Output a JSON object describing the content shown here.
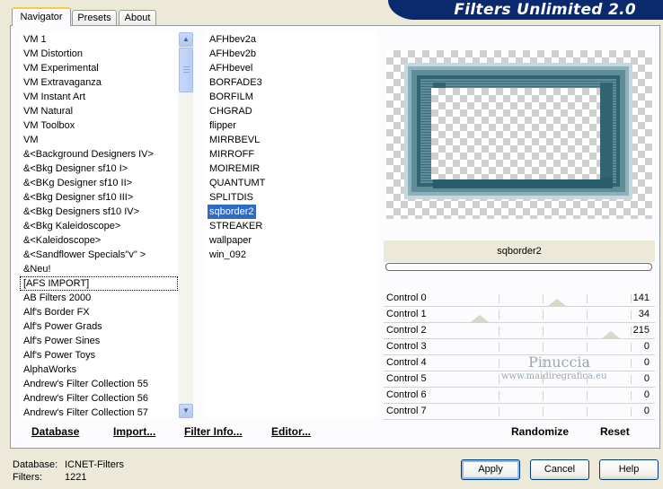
{
  "banner": {
    "title": "Filters Unlimited 2.0"
  },
  "tabs": [
    {
      "label": "Navigator",
      "active": true
    },
    {
      "label": "Presets",
      "active": false
    },
    {
      "label": "About",
      "active": false
    }
  ],
  "categories": [
    "VM 1",
    "VM Distortion",
    "VM Experimental",
    "VM Extravaganza",
    "VM Instant Art",
    "VM Natural",
    "VM Toolbox",
    "VM",
    "&<Background Designers IV>",
    "&<Bkg Designer sf10 I>",
    "&<BKg Designer sf10 II>",
    "&<Bkg Designer sf10 III>",
    "&<Bkg Designers sf10 IV>",
    "&<Bkg Kaleidoscope>",
    "&<Kaleidoscope>",
    "&<Sandflower Specials\"v\" >",
    "&Neu!",
    "[AFS IMPORT]",
    "AB Filters 2000",
    "Alf's Border FX",
    "Alf's Power Grads",
    "Alf's Power Sines",
    "Alf's Power Toys",
    "AlphaWorks",
    "Andrew's Filter Collection 55",
    "Andrew's Filter Collection 56",
    "Andrew's Filter Collection 57"
  ],
  "selected_category_index": 17,
  "filters": [
    "AFHbev2a",
    "AFHbev2b",
    "AFHbevel",
    "BORFADE3",
    "BORFILM",
    "CHGRAD",
    "flipper",
    "MIRRBEVL",
    "MIRROFF",
    "MOIREMIR",
    "QUANTUMT",
    "SPLITDIS",
    "sqborder2",
    "STREAKER",
    "wallpaper",
    "win_092"
  ],
  "selected_filter_index": 12,
  "filter_name": "sqborder2",
  "controls": [
    {
      "label": "Control 0",
      "value": "141",
      "level": 141
    },
    {
      "label": "Control 1",
      "value": "34",
      "level": 34
    },
    {
      "label": "Control 2",
      "value": "215",
      "level": 215
    },
    {
      "label": "Control 3",
      "value": "0",
      "level": 0
    },
    {
      "label": "Control 4",
      "value": "0",
      "level": 0
    },
    {
      "label": "Control 5",
      "value": "0",
      "level": 0
    },
    {
      "label": "Control 6",
      "value": "0",
      "level": 0
    },
    {
      "label": "Control 7",
      "value": "0",
      "level": 0
    }
  ],
  "watermark": {
    "name": "Pinuccia",
    "url": "www.maidiregrafica.eu"
  },
  "links": {
    "database": "Database",
    "import": "Import...",
    "filter_info": "Filter Info...",
    "editor": "Editor...",
    "randomize": "Randomize",
    "reset": "Reset"
  },
  "status": {
    "database_label": "Database:",
    "database_value": "ICNET-Filters",
    "filters_label": "Filters:",
    "filters_value": "1221"
  },
  "buttons": {
    "apply": "Apply",
    "cancel": "Cancel",
    "help": "Help"
  },
  "colors": {
    "selection": "#316ac5",
    "banner": "#0b2a6e",
    "dialog": "#ece9d8"
  }
}
